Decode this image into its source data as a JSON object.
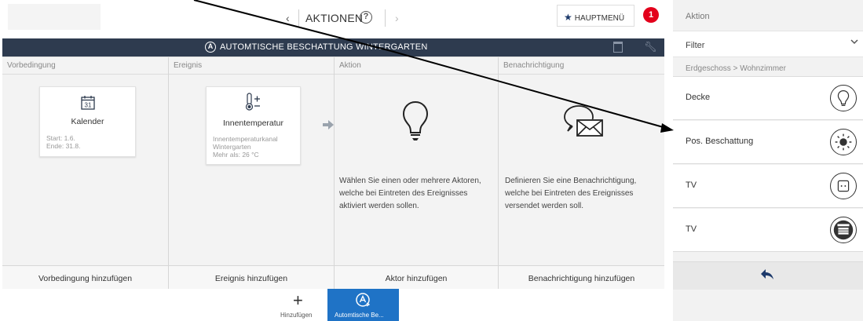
{
  "topbar": {
    "back_arrow": "‹",
    "title": "AKTIONEN",
    "help_glyph": "?",
    "forward_arrow": "›",
    "menu_label": "HAUPTMENÜ",
    "notification_count": "1"
  },
  "titlebar": {
    "text": "AUTOMTISCHE BESCHATTUNG WINTERGARTEN"
  },
  "columns": {
    "precondition": {
      "header": "Vorbedingung",
      "footer": "Vorbedingung hinzufügen",
      "card": {
        "icon_text": "31",
        "title": "Kalender",
        "info": [
          "Start: 1.6.",
          "Ende: 31.8."
        ]
      }
    },
    "event": {
      "header": "Ereignis",
      "footer": "Ereignis hinzufügen",
      "card": {
        "title": "Innentemperatur",
        "info": [
          "Innentemperaturkanal",
          "Wintergarten",
          "Mehr als: 26 °C"
        ]
      }
    },
    "action": {
      "header": "Aktion",
      "footer": "Aktor hinzufügen",
      "description": [
        "Wählen Sie einen oder mehrere Aktoren,",
        "welche bei Eintreten des Ereignisses",
        "aktiviert werden sollen."
      ]
    },
    "notification": {
      "header": "Benachrichtigung",
      "footer": "Benachrichtigung hinzufügen",
      "description": [
        "Definieren Sie eine Benachrichtigung,",
        "welche bei Eintreten des Ereignisses",
        "versendet werden soll."
      ]
    }
  },
  "bottombar": {
    "add_label": "Hinzufügen",
    "active_tab_label": "Automtische Be..."
  },
  "panel": {
    "header": "Aktion",
    "filter_label": "Filter",
    "breadcrumb": "Erdgeschoss > Wohnzimmer",
    "devices": [
      {
        "label": "Decke",
        "icon": "light-bulb-icon"
      },
      {
        "label": "Pos. Beschattung",
        "icon": "sun-icon"
      },
      {
        "label": "TV",
        "icon": "socket-icon"
      },
      {
        "label": "TV",
        "icon": "blind-icon"
      }
    ]
  },
  "colors": {
    "titlebar_bg": "#2e3b4f",
    "accent_blue": "#1f73c6",
    "badge_red": "#e3001b",
    "navy": "#1d3a6b"
  }
}
